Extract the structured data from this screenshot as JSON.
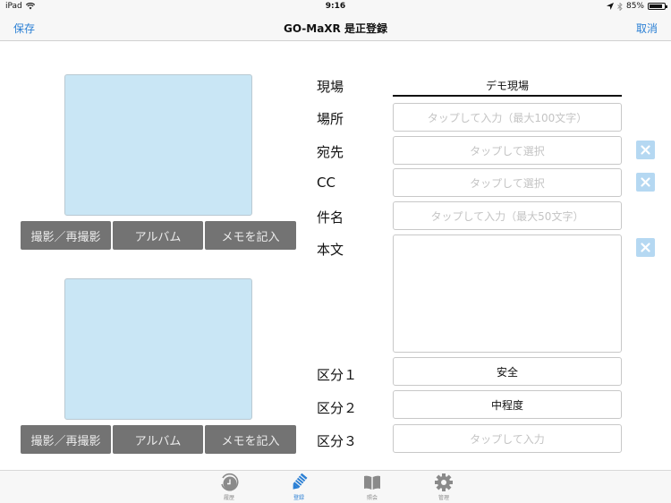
{
  "status_bar": {
    "device": "iPad",
    "time": "9:16",
    "battery_percent": "85%",
    "battery_level": 0.85
  },
  "nav": {
    "left_button": "保存",
    "title": "GO-MaXR 是正登録",
    "right_button": "取消"
  },
  "photos": [
    {
      "buttons": [
        "撮影／再撮影",
        "アルバム",
        "メモを記入"
      ]
    },
    {
      "buttons": [
        "撮影／再撮影",
        "アルバム",
        "メモを記入"
      ]
    }
  ],
  "form": {
    "site": {
      "label": "現場",
      "value": "デモ現場"
    },
    "location": {
      "label": "場所",
      "placeholder": "タップして入力（最大100文字）"
    },
    "to": {
      "label": "宛先",
      "placeholder": "タップして選択"
    },
    "cc": {
      "label": "CC",
      "placeholder": "タップして選択"
    },
    "subject": {
      "label": "件名",
      "placeholder": "タップして入力（最大50文字）"
    },
    "body": {
      "label": "本文",
      "value": ""
    },
    "category1": {
      "label": "区分１",
      "value": "安全"
    },
    "category2": {
      "label": "区分２",
      "value": "中程度"
    },
    "category3": {
      "label": "区分３",
      "placeholder": "タップして入力"
    }
  },
  "tabs": [
    {
      "label": "履歴",
      "icon": "history-clock-icon",
      "active": false
    },
    {
      "label": "登録",
      "icon": "pencil-icon",
      "active": true
    },
    {
      "label": "照会",
      "icon": "book-icon",
      "active": false
    },
    {
      "label": "管理",
      "icon": "gear-icon",
      "active": false
    }
  ],
  "colors": {
    "accent": "#2a7fd4",
    "photo_placeholder": "#c9e6f5",
    "photo_button": "#737373",
    "clear_button": "#b5d8f2"
  }
}
